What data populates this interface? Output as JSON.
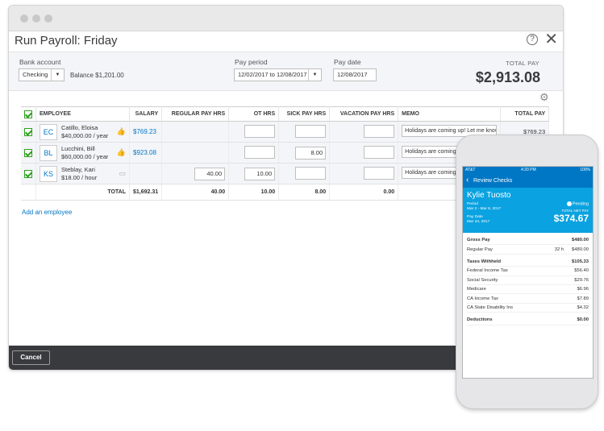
{
  "window": {
    "title": "Run Payroll: Friday"
  },
  "settings": {
    "bank_account_label": "Bank account",
    "bank_account_value": "Checking",
    "balance": "Balance $1,201.00",
    "pay_period_label": "Pay period",
    "pay_period_value": "12/02/2017 to 12/08/2017",
    "pay_date_label": "Pay date",
    "pay_date_value": "12/08/2017",
    "total_pay_label": "TOTAL PAY",
    "total_pay_value": "$2,913.08"
  },
  "table": {
    "headers": {
      "employee": "EMPLOYEE",
      "salary": "SALARY",
      "regular": "REGULAR PAY HRS",
      "ot": "OT HRS",
      "sick": "SICK PAY HRS",
      "vacation": "VACATION PAY HRS",
      "memo": "MEMO",
      "total": "TOTAL PAY"
    },
    "rows": [
      {
        "initials": "EC",
        "name": "Catillo, Eloisa",
        "rate": "$40,000.00 / year",
        "salary": "$769.23",
        "regular": "",
        "ot": "",
        "sick": "",
        "vacation": "",
        "memo": "Holidays are coming up! Let me know",
        "total": "$769.23"
      },
      {
        "initials": "BL",
        "name": "Lucchini, Bill",
        "rate": "$60,000.00 / year",
        "salary": "$923.08",
        "regular": "",
        "ot": "",
        "sick": "8.00",
        "vacation": "",
        "memo": "Holidays are coming up",
        "total": ""
      },
      {
        "initials": "KS",
        "name": "Steblay, Kari",
        "rate": "$18.00 / hour",
        "salary": "",
        "regular": "40.00",
        "ot": "10.00",
        "sick": "",
        "vacation": "",
        "memo": "Holidays are coming up",
        "total": ""
      }
    ],
    "totals": {
      "label": "TOTAL",
      "salary": "$1,692.31",
      "regular": "40.00",
      "ot": "10.00",
      "sick": "8.00",
      "vacation": "0.00"
    }
  },
  "add_employee": "Add an employee",
  "footer": {
    "cancel": "Cancel"
  },
  "phone": {
    "carrier": "AT&T",
    "time": "4:20 PM",
    "battery": "100%",
    "nav_title": "Review Checks",
    "employee": "Kylie Tuosto",
    "period_label": "Period",
    "period_value": "Mar 2 - Mar 8, 2017",
    "pay_date_label": "Pay Date",
    "pay_date_value": "Mar 10, 2017",
    "status": "Pending",
    "net_label": "TOTAL NET PAY",
    "net_value": "$374.67",
    "gross_label": "Gross Pay",
    "gross_value": "$480.00",
    "regular_label": "Regular Pay",
    "regular_hrs": "32 h",
    "regular_value": "$480.00",
    "taxes_label": "Taxes Withheld",
    "taxes_value": "$105.33",
    "taxes": [
      {
        "label": "Federal Income Tax",
        "value": "$56.40"
      },
      {
        "label": "Social Security",
        "value": "$29.76"
      },
      {
        "label": "Medicare",
        "value": "$6.96"
      },
      {
        "label": "CA Income Tax",
        "value": "$7.89"
      },
      {
        "label": "CA State Disability Ins",
        "value": "$4.32"
      }
    ],
    "deductions_label": "Deductions",
    "deductions_value": "$0.00"
  }
}
